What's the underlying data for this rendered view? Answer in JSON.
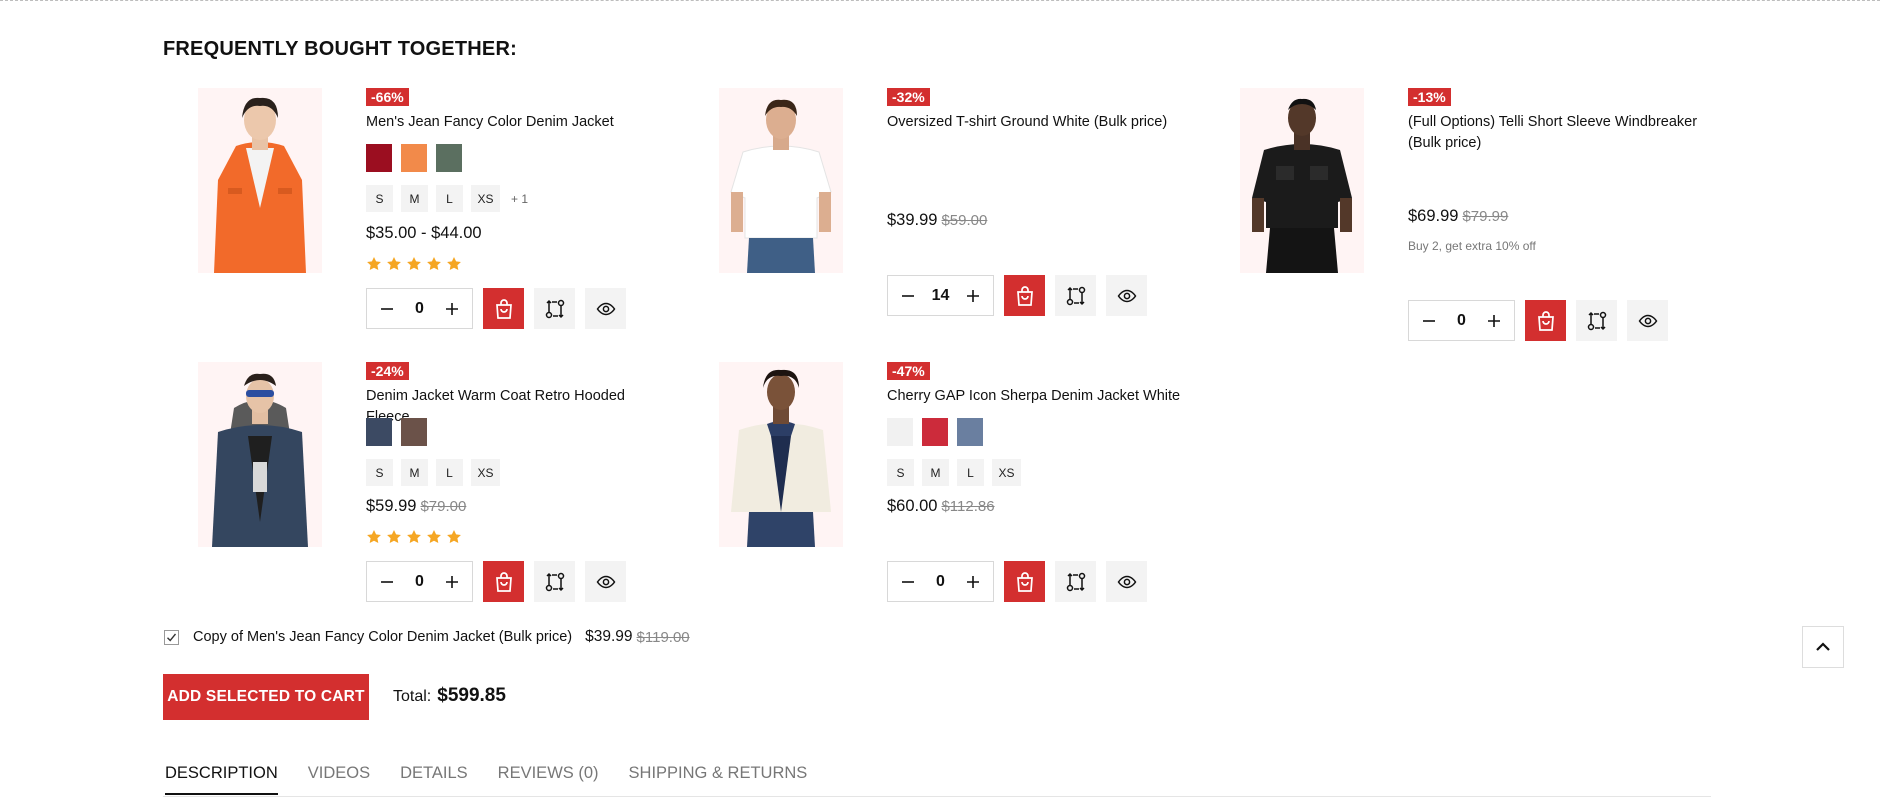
{
  "section": {
    "title": "FREQUENTLY BOUGHT TOGETHER:"
  },
  "colors": {
    "accent": "#d32f2f",
    "star": "#f5a623",
    "image_bg": "#fff4f4"
  },
  "products": [
    {
      "badge": "-66%",
      "name": "Men's Jean Fancy Color Denim Jacket",
      "swatches": [
        "#9b0e20",
        "#f28a4a",
        "#5b6f60"
      ],
      "sizes": [
        "S",
        "M",
        "L",
        "XS"
      ],
      "sizes_more": "+ 1",
      "price": "$35.00 - $44.00",
      "old_price": "",
      "rating": 5,
      "qty": "0",
      "image": "orange-denim-jacket-model"
    },
    {
      "badge": "-32%",
      "name": "Oversized T-shirt Ground White (Bulk price)",
      "price": "$39.99",
      "old_price": "$59.00",
      "qty": "14",
      "image": "white-tshirt-model"
    },
    {
      "badge": "-13%",
      "name": "(Full Options) Telli Short Sleeve Windbreaker (Bulk price)",
      "price": "$69.99",
      "old_price": "$79.99",
      "note": "Buy 2, get extra 10% off",
      "qty": "0",
      "image": "black-windbreaker-model"
    },
    {
      "badge": "-24%",
      "name": "Denim Jacket Warm Coat Retro Hooded Fleece",
      "swatches": [
        "#3c4a63",
        "#6b5249"
      ],
      "sizes": [
        "S",
        "M",
        "L",
        "XS"
      ],
      "price": "$59.99",
      "old_price": "$79.00",
      "rating": 5,
      "qty": "0",
      "image": "hooded-denim-jacket-model"
    },
    {
      "badge": "-47%",
      "name": "Cherry GAP Icon Sherpa Denim Jacket White",
      "swatches": [
        "#f1f1f1",
        "#cc2b3b",
        "#6a7fa0"
      ],
      "sizes": [
        "S",
        "M",
        "L",
        "XS"
      ],
      "price": "$60.00",
      "old_price": "$112.86",
      "qty": "0",
      "image": "sherpa-jacket-model"
    }
  ],
  "bundle": {
    "checked": true,
    "label": "Copy of Men's Jean Fancy Color Denim Jacket (Bulk price)",
    "price": "$39.99",
    "old_price": "$119.00"
  },
  "cart": {
    "add_selected_label": "ADD SELECTED TO CART",
    "total_label": "Total:",
    "total_value": "$599.85"
  },
  "tabs": [
    {
      "label": "DESCRIPTION",
      "active": true
    },
    {
      "label": "VIDEOS",
      "active": false
    },
    {
      "label": "DETAILS",
      "active": false
    },
    {
      "label": "REVIEWS (0)",
      "active": false
    },
    {
      "label": "SHIPPING & RETURNS",
      "active": false
    }
  ],
  "icons": {
    "cart": "shopping-bag-icon",
    "compare": "compare-icon",
    "quick_view": "eye-icon",
    "back_to_top": "chevron-up-icon"
  }
}
